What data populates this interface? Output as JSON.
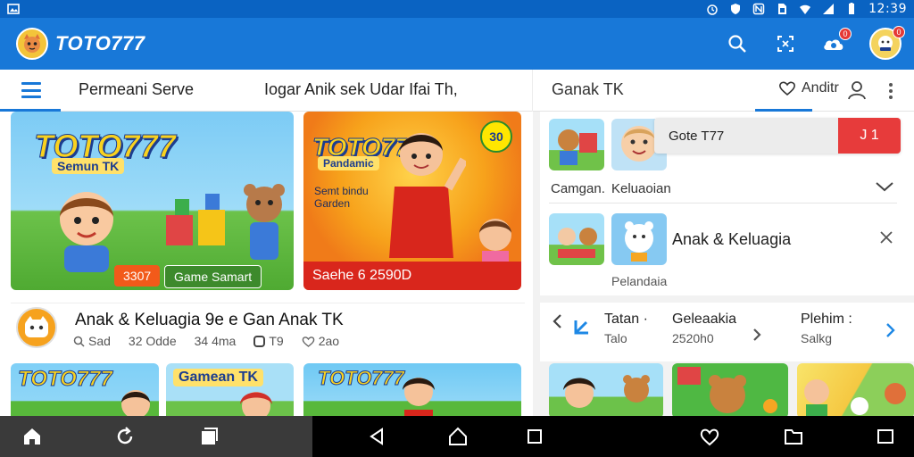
{
  "status_bar": {
    "time": "12:39",
    "left_icon": "image-notification-icon",
    "icons": [
      "alarm-icon",
      "shield-icon",
      "nfc-icon",
      "sim-icon",
      "wifi-icon",
      "signal-icon",
      "battery-icon"
    ]
  },
  "app_bar": {
    "title": "TOTO777",
    "logo_icon": "cat-logo-icon",
    "actions": [
      "search-icon",
      "cast-icon",
      "cloud-notification-icon",
      "account-avatar"
    ],
    "notification_count": "0",
    "avatar_badge": "0",
    "accent_color": "#1878d8"
  },
  "tabs": {
    "tab_1": "Permeani Serve",
    "tab_2": "Iogar Anik sek Udar Ifai Th,",
    "tab_3": "Ganak TK",
    "tab_3_right": "Anditr"
  },
  "left": {
    "banner_1": {
      "logo": "TOTO777",
      "subtitle": "Semun TK",
      "badge_left": "3307",
      "badge_right": "Game Samart"
    },
    "banner_2": {
      "logo": "TOTO777",
      "subtitle": "Pandamic",
      "badge": "30",
      "side_text_1": "Semt bindu",
      "side_text_2": "Garden",
      "footer": "Saehe 6 2590D"
    },
    "info": {
      "title": "Anak & Keluagia 9e e Gan Anak TK",
      "meta": [
        {
          "icon": "search-icon",
          "text": "Sad"
        },
        {
          "icon": "",
          "text": "32 Odde"
        },
        {
          "icon": "",
          "text": "34 4ma"
        },
        {
          "icon": "stop-icon",
          "text": "T9"
        },
        {
          "icon": "heart-icon",
          "text": "2ao"
        }
      ]
    },
    "thumbs": [
      {
        "logo": "TOTO777"
      },
      {
        "label": "Gamean TK"
      },
      {
        "logo": "TOTO777"
      }
    ]
  },
  "right": {
    "toast": {
      "text": "Gote T77",
      "button": "J 1"
    },
    "label_1": "Camgan.",
    "label_2": "Keluaoian",
    "section_title": "Anak & Keluagia",
    "caption": "Pelandaia",
    "columns": [
      {
        "title": "Tatan ·",
        "sub": "Talo"
      },
      {
        "title": "Geleaakia",
        "sub": "2520h0"
      },
      {
        "title": "Plehim :",
        "sub": "Salkg"
      }
    ]
  },
  "nav_bar": {
    "left_icons": [
      "home-icon",
      "refresh-icon",
      "window-icon"
    ],
    "center_icons": [
      "back-icon",
      "home-icon",
      "recents-icon"
    ],
    "right_icons": [
      "heart-icon",
      "folder-icon",
      "square-icon"
    ]
  }
}
